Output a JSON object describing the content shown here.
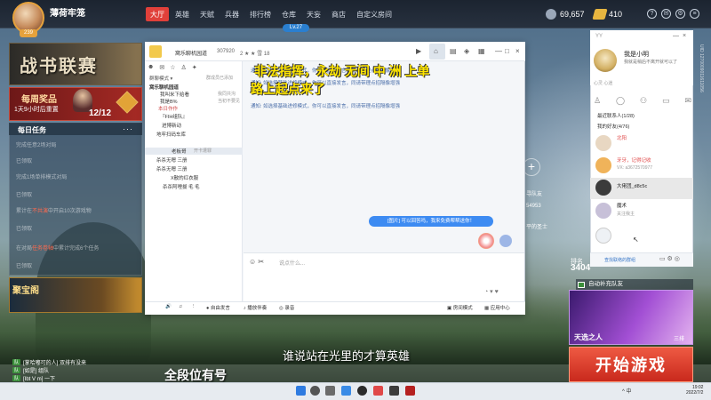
{
  "topbar": {
    "username": "薄荷牢笼",
    "avatar_level": "239",
    "nav": [
      "大厅",
      "英雄",
      "天赋",
      "兵器",
      "排行榜",
      "仓库",
      "天妄",
      "商店",
      "自定义房间"
    ],
    "level": "Lv.27",
    "coins": "69,657",
    "gold": "410",
    "icons": [
      "help-icon",
      "mail-icon",
      "settings-icon",
      "menu-icon"
    ]
  },
  "left": {
    "banner": "战书联赛",
    "reward_title": "每周奖品",
    "reward_sub": "1天9小时后重置",
    "reward_count": "12/12",
    "daily_title": "每日任务",
    "daily_more": "···",
    "tasks": [
      {
        "text": "完成任意2场对局",
        "highlight": ""
      },
      {
        "text": "已领取",
        "highlight": ""
      },
      {
        "text": "完成1场单排模式对局",
        "highlight": ""
      },
      {
        "text": "已领取",
        "highlight": ""
      },
      {
        "text": "累计在",
        "highlight": "不共演",
        "rest": "中开启10次游戏物"
      },
      {
        "text": "已领取",
        "highlight": ""
      },
      {
        "text": "在对局",
        "highlight": "任务卷轴",
        "rest": "中累计完成6个任务"
      },
      {
        "text": "已领取",
        "highlight": ""
      }
    ],
    "treasure": "聚宝阁"
  },
  "chat_lines": [
    {
      "tag": "队",
      "text": "[掌哈嘟可的人] 双排有没来"
    },
    {
      "tag": "队",
      "text": "[如是] 组队"
    },
    {
      "tag": "队",
      "text": "[Ibt V m] 一下"
    }
  ],
  "window": {
    "group_name": "窝乐聊机园道",
    "group_id": "307920",
    "stats": "2 ★ ★ 雪 18",
    "tab_chat": "群聊模式",
    "tab_hint": "群成员已添加",
    "sidebar": [
      {
        "text": "窝乐聊机园道"
      },
      {
        "text": "我叫米下给看",
        "right": "我同共沟"
      },
      {
        "text": "我是B%",
        "right": "当初不要见"
      },
      {
        "text": "本日作作"
      },
      {
        "text": "『FIH组队』"
      },
      {
        "text": "进博新动"
      },
      {
        "text": "地牢扫码车库"
      },
      {
        "text": "老板哥",
        "right": "开卡遭罪"
      },
      {
        "text": "杀杀无嗯 三册"
      },
      {
        "text": "杀杀无嗯 三册"
      },
      {
        "text": "X散的红衣服"
      },
      {
        "text": "杀杀阿哩拔 毛 毛"
      }
    ],
    "sys_messages": [
      "通知: 如选择基础进修模式，你可以直接发言，同请带理点招隔像增强",
      "通知: 如选择基础进修模式，你可以直接发言，同请带理点招隔像增强",
      "通知: 如选择基础进修模式，你可以直接发言，同请带理点招隔像增强"
    ],
    "overlay1": "非法指挥，永劫 无间  中  洲  上单",
    "overlay2": "路上起点来了",
    "bubble": "[图片] 可以回答吗，我来免费帮帮送你！",
    "input_placeholder": "说点什么...",
    "bottom_items": [
      "自由发言",
      "播放伴奏",
      "录音",
      "房间模式",
      "应用中心"
    ]
  },
  "friend_panel": {
    "name": "我是小明",
    "signature": "我就是稍后不离开就可以了",
    "status": "心灵 心迷",
    "groups": [
      "最近联系人(1/28)",
      "我的好友(4/76)"
    ],
    "friends": [
      {
        "name": "北阳",
        "sub": "",
        "color": "#e8d7c2"
      },
      {
        "name": "牙牙，记得记收",
        "sub": "VX: a3672570977",
        "color": "#f0b35a"
      },
      {
        "name": "大佬团_d8c5c",
        "sub": "",
        "color": "#3b3b3b"
      },
      {
        "name": "魔术",
        "sub": "关注我主",
        "color": "#c7c0d8"
      },
      {
        "name": "",
        "sub": "",
        "color": "#ffffff"
      }
    ],
    "bottom_text": "查找联络的群组"
  },
  "game_right": {
    "rank_label": "排名",
    "rank_value": "3404",
    "auto_match": "自动补充队友",
    "hero_name": "天选之人",
    "hero_sub": "三排",
    "start": "开始游戏",
    "side1": "寻队友",
    "side2": "54953",
    "side3": "平的圣士"
  },
  "vertical_text": "UID 1270009011611056",
  "subtitles": {
    "line1": "谁说站在光里的才算英雄",
    "line2": "全段位有号"
  },
  "taskbar": {
    "tray": "^ 中",
    "time": "19:02",
    "date": "2022/7/2"
  }
}
